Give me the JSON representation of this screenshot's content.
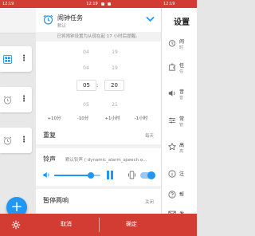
{
  "status": {
    "time_left": "12:19",
    "time_mid": "12:19",
    "time_right": "12:19"
  },
  "dialog": {
    "title": "闹钟任务",
    "subtitle": "默认",
    "info": "已将闹钟设置为从现在起 17 小时后提醒。",
    "picker": {
      "hour_prev2": "04",
      "hour_prev": "04",
      "hour": "05",
      "hour_next": "05",
      "colon": ":",
      "minute_prev2": "19",
      "minute_prev": "19",
      "minute": "20",
      "minute_next": "21"
    },
    "increments": [
      "+10分",
      "-10分",
      "+1小时",
      "-1小时"
    ],
    "repeat": {
      "label": "重复",
      "value": "每天"
    },
    "ringtone": {
      "label": "铃声",
      "value": "默认铃声 ( dynamic_alarm_speech.o...",
      "volume_percent": 80,
      "vibrate_on": true
    },
    "snooze": {
      "label": "暂停两响",
      "value": "关闭"
    }
  },
  "settings": {
    "title": "设置",
    "rows": [
      {
        "title": "闹",
        "sub": "时"
      },
      {
        "title": "任",
        "sub": "任"
      },
      {
        "title": "音",
        "sub": "音"
      },
      {
        "title": "常",
        "sub": "管"
      },
      {
        "title": "高",
        "sub": "高"
      },
      {
        "title": "注",
        "sub": ""
      },
      {
        "title": "帮",
        "sub": ""
      },
      {
        "title": "发",
        "sub": ""
      }
    ]
  },
  "bottom": {
    "cancel_label": "取消",
    "ok_label": "确定"
  },
  "colors": {
    "accent": "#2196f3",
    "bar": "#d33c32"
  }
}
